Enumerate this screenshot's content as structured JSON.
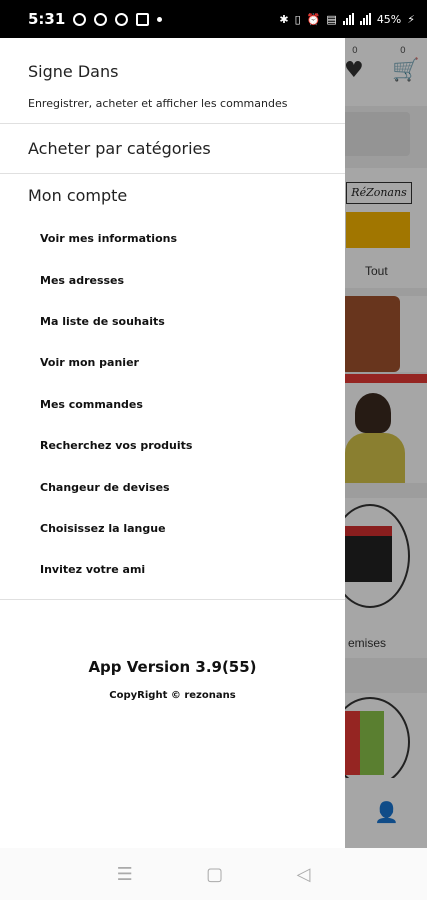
{
  "status_bar": {
    "time": "5:31",
    "battery": "45%",
    "left_icons": [
      "whatsapp-icon",
      "app-icon",
      "messenger-icon",
      "teams-icon",
      "dot-icon"
    ],
    "right_icons": [
      "bluetooth-icon",
      "vibrate-icon",
      "alarm-icon",
      "volte-icon",
      "signal-icon",
      "signal-icon",
      "battery-icon"
    ]
  },
  "background_app": {
    "wishlist_count": "0",
    "cart_count": "0",
    "brand_text": "RéZonans",
    "category_all": "Tout",
    "category_chemises": "emises"
  },
  "drawer": {
    "signin_title": "Signe Dans",
    "signin_subtitle": "Enregistrer, acheter et afficher les commandes",
    "shop_by_category": "Acheter par catégories",
    "account_title": "Mon compte",
    "menu_items": [
      "Voir mes informations",
      "Mes adresses",
      "Ma liste de souhaits",
      "Voir mon panier",
      "Mes commandes",
      "Recherchez vos produits",
      "Changeur de devises",
      "Choisissez la langue",
      "Invitez votre ami"
    ],
    "app_version": "App Version 3.9(55)",
    "copyright": "CopyRight © rezonans"
  },
  "nav_bar": {
    "icons": [
      "recents-icon",
      "home-icon",
      "back-icon"
    ]
  },
  "colors": {
    "overlay": "#000000",
    "drawer_bg": "#ffffff",
    "divider": "#e0e0e0",
    "banner_red": "#e53935"
  }
}
